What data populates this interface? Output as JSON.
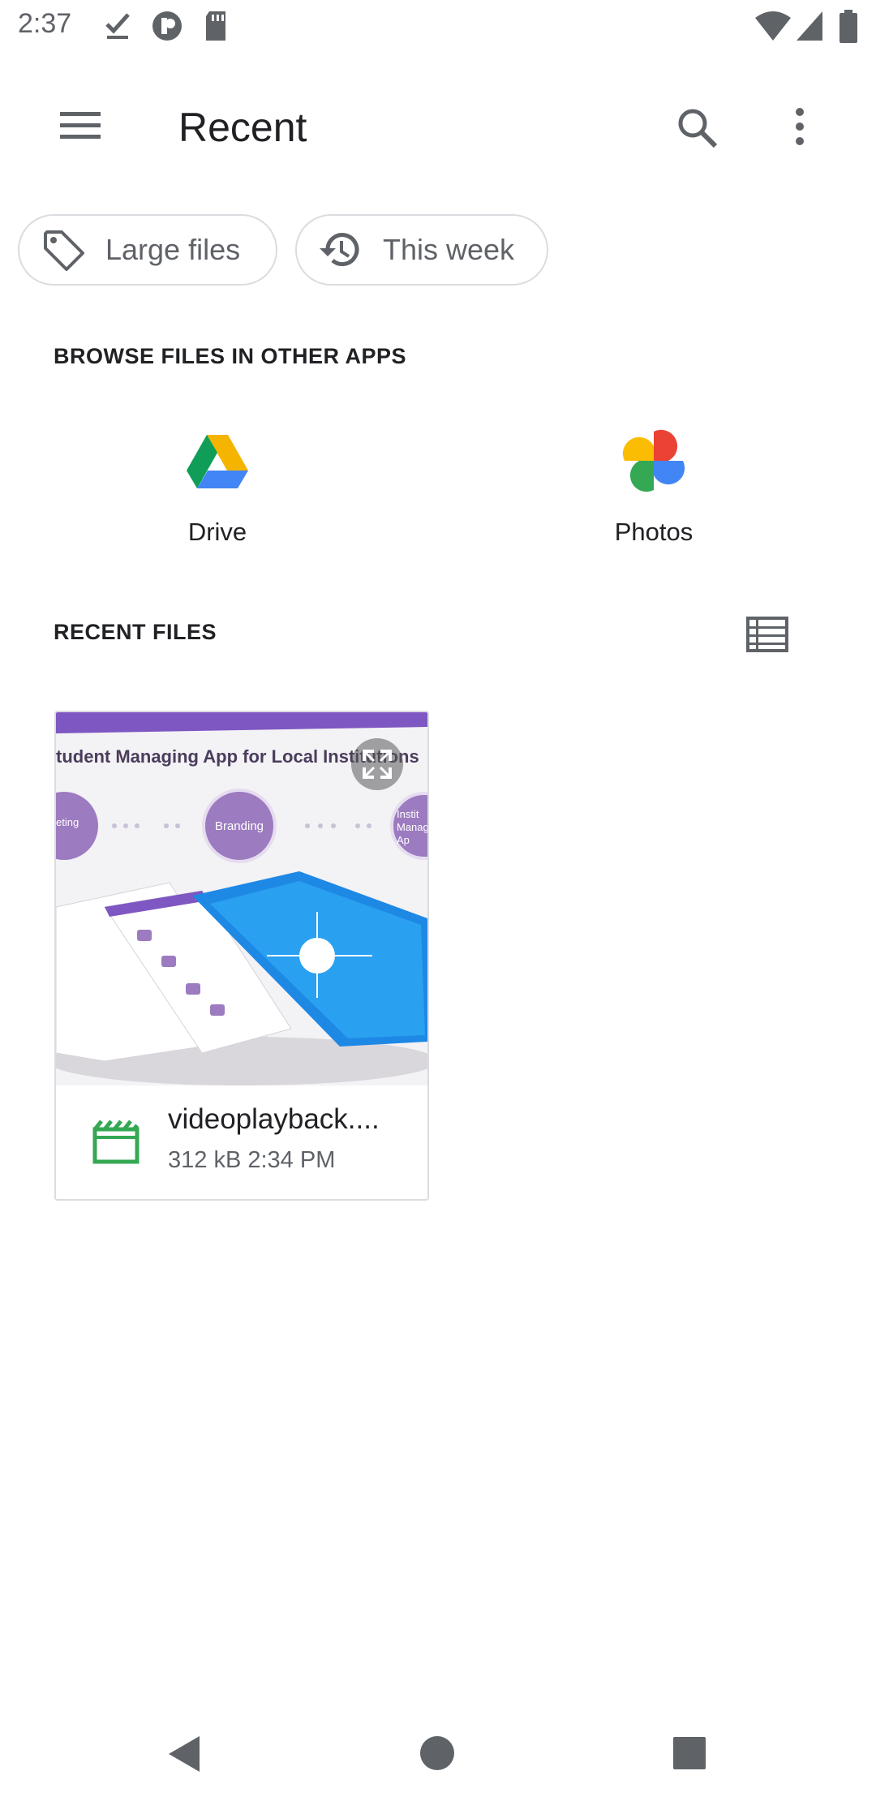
{
  "status_bar": {
    "time": "2:37"
  },
  "app_bar": {
    "title": "Recent",
    "icons": [
      "menu-icon",
      "search-icon",
      "more-vert-icon"
    ]
  },
  "chips": [
    {
      "label": "Large files",
      "icon": "tag-icon"
    },
    {
      "label": "This week",
      "icon": "history-icon"
    }
  ],
  "browse_section": {
    "heading": "BROWSE FILES IN OTHER APPS",
    "apps": [
      {
        "label": "Drive",
        "icon": "google-drive-icon"
      },
      {
        "label": "Photos",
        "icon": "google-photos-icon"
      }
    ]
  },
  "recent_section": {
    "heading": "RECENT FILES",
    "view_toggle_icon": "list-view-icon"
  },
  "files": [
    {
      "name": "videoplayback....",
      "size": "312 kB",
      "time": "2:34 PM",
      "type_icon": "movie-icon",
      "thumbnail": {
        "caption": "tudent Managing App for Local Institutions",
        "bubbles": [
          "eting",
          "Branding",
          "Instit Manage Ap"
        ]
      }
    }
  ],
  "colors": {
    "accent_green": "#34a853",
    "thumb_purple": "#7e57c2",
    "text_primary": "#202124",
    "text_secondary": "#5f6368"
  }
}
